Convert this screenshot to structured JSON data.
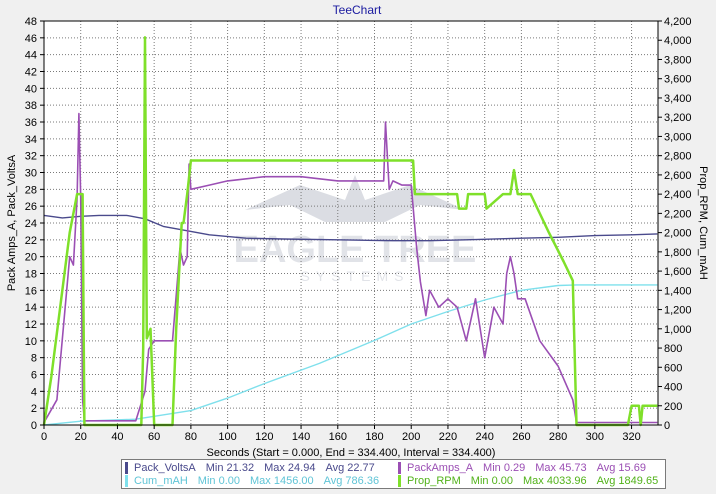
{
  "chart_data": {
    "type": "line",
    "title": "TeeChart",
    "xlabel": "Seconds (Start = 0.000,  End = 334.400,  Interval = 334.400)",
    "ylabel_left": "Pack Amps_A, Pack_VoltsA",
    "ylabel_right": "Prop_RPM, Cum_mAH",
    "x_range": [
      0,
      334.4
    ],
    "y_left_range": [
      0,
      48
    ],
    "y_right_range": [
      0,
      4200
    ],
    "x_ticks": [
      0,
      20,
      40,
      60,
      80,
      100,
      120,
      140,
      160,
      180,
      200,
      220,
      240,
      260,
      280,
      300,
      320
    ],
    "y_left_ticks": [
      0,
      2,
      4,
      6,
      8,
      10,
      12,
      14,
      16,
      18,
      20,
      22,
      24,
      26,
      28,
      30,
      32,
      34,
      36,
      38,
      40,
      42,
      44,
      46,
      48
    ],
    "y_right_ticks": [
      "0",
      "200",
      "400",
      "600",
      "800",
      "1,000",
      "1,200",
      "1,400",
      "1,600",
      "1,800",
      "2,000",
      "2,200",
      "2,400",
      "2,600",
      "2,800",
      "3,000",
      "3,200",
      "3,400",
      "3,600",
      "3,800",
      "4,000",
      "4,200"
    ],
    "grid": true,
    "watermark": {
      "line1": "EAGLE TREE",
      "line2": "SYSTEMS"
    },
    "series": [
      {
        "name": "Pack_VoltsA",
        "axis": "left",
        "color": "#4a4a8c",
        "stats": {
          "min": "21.32",
          "max": "24.94",
          "avg": "22.77"
        },
        "x": [
          0,
          10,
          20,
          30,
          45,
          55,
          65,
          80,
          90,
          110,
          130,
          160,
          190,
          210,
          230,
          260,
          280,
          300,
          320,
          334
        ],
        "y": [
          24.9,
          24.6,
          24.8,
          24.9,
          24.9,
          24.5,
          23.6,
          23.0,
          22.6,
          22.2,
          22.1,
          22.0,
          21.9,
          21.9,
          22.0,
          22.2,
          22.3,
          22.5,
          22.6,
          22.7
        ]
      },
      {
        "name": "PackAmps_A",
        "axis": "left",
        "color": "#9b4fb4",
        "stats": {
          "min": "0.29",
          "max": "45.73",
          "avg": "15.69"
        },
        "x": [
          0,
          7,
          14,
          16,
          18,
          19,
          20,
          21,
          22,
          50,
          55,
          57,
          60,
          63,
          66,
          70,
          73,
          74,
          76,
          78,
          79,
          80,
          90,
          100,
          120,
          140,
          160,
          180,
          185,
          186,
          188,
          190,
          195,
          200,
          203,
          205,
          208,
          210,
          215,
          220,
          225,
          230,
          235,
          240,
          245,
          250,
          252,
          254,
          255,
          256,
          258,
          262,
          270,
          280,
          288,
          290,
          300,
          334
        ],
        "y": [
          0.3,
          3,
          20,
          19,
          27,
          37,
          27,
          3,
          0.5,
          0.5,
          4,
          9,
          10,
          10,
          10,
          10,
          18,
          21,
          19,
          20,
          31,
          28,
          28.5,
          29,
          29.5,
          29.5,
          29,
          29,
          29,
          36,
          28,
          29,
          28.5,
          28.5,
          21,
          17,
          13,
          16,
          14,
          15,
          14,
          10,
          15,
          8,
          14,
          12,
          18,
          20,
          19,
          18,
          15,
          15,
          10,
          7,
          3,
          0.3,
          0.3,
          0.3
        ]
      },
      {
        "name": "Cum_mAH",
        "axis": "right",
        "color": "#7fe0ec",
        "stats": {
          "min": "0.00",
          "max": "1456.00",
          "avg": "786.36"
        },
        "x": [
          0,
          20,
          50,
          80,
          100,
          120,
          150,
          180,
          200,
          220,
          240,
          260,
          280,
          290,
          334
        ],
        "y": [
          0,
          40,
          60,
          150,
          280,
          430,
          640,
          880,
          1050,
          1180,
          1300,
          1400,
          1450,
          1456,
          1456
        ]
      },
      {
        "name": "Prop_RPM",
        "axis": "right",
        "color": "#7fe02a",
        "stats": {
          "min": "0.00",
          "max": "4033.96",
          "avg": "1849.65"
        },
        "x": [
          0,
          4,
          14,
          18,
          21,
          22,
          53,
          54,
          55,
          56,
          58,
          60,
          70,
          72,
          75,
          76,
          78,
          80,
          200,
          201,
          202,
          220,
          225,
          226,
          230,
          231,
          240,
          241,
          250,
          254,
          256,
          258,
          265,
          275,
          283,
          288,
          290,
          318,
          320,
          324,
          325,
          326,
          334
        ],
        "y": [
          0,
          500,
          2000,
          2400,
          2400,
          0,
          0,
          800,
          4030,
          900,
          1000,
          0,
          0,
          1000,
          2100,
          2100,
          2400,
          2750,
          2750,
          2750,
          2400,
          2400,
          2400,
          2250,
          2250,
          2400,
          2400,
          2250,
          2400,
          2400,
          2650,
          2400,
          2400,
          2000,
          1700,
          1500,
          0,
          0,
          200,
          200,
          0,
          200,
          200
        ]
      }
    ]
  }
}
